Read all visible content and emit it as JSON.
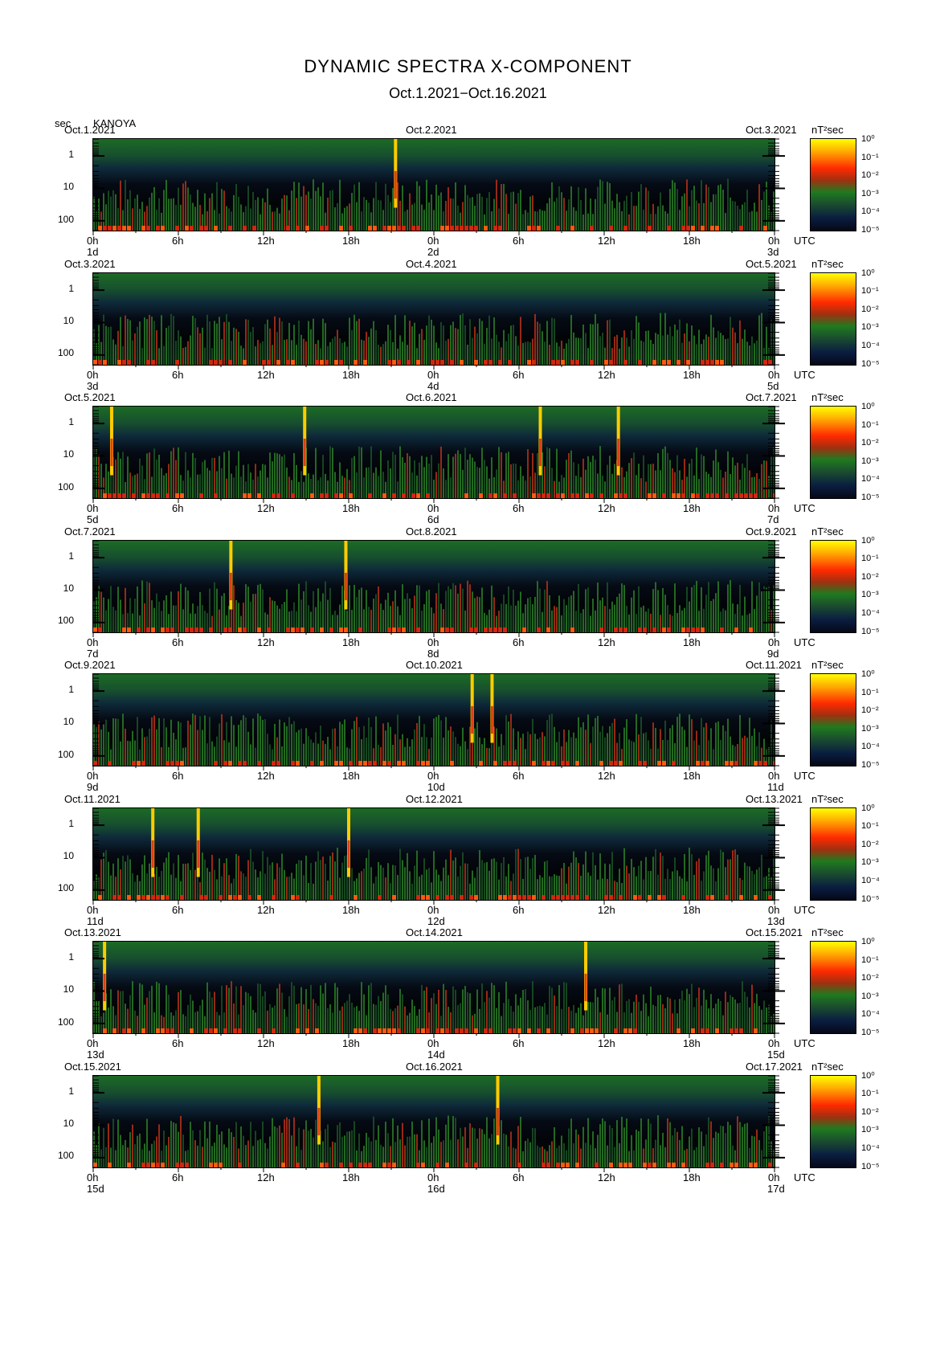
{
  "title": "DYNAMIC SPECTRA X-COMPONENT",
  "subtitle": "Oct.1.2021−Oct.16.2021",
  "y_unit": "sec",
  "station": "KANOYA",
  "colorbar_unit": "nT²sec",
  "colorbar_ticks": [
    "10⁰",
    "10⁻¹",
    "10⁻²",
    "10⁻³",
    "10⁻⁴",
    "10⁻⁵"
  ],
  "x_tick_labels": [
    "0h",
    "6h",
    "12h",
    "18h",
    "0h",
    "6h",
    "12h",
    "18h",
    "0h"
  ],
  "x_unit": "UTC",
  "y_tick_labels": [
    "1",
    "10",
    "100"
  ],
  "chart_data": {
    "type": "heatmap",
    "title": "DYNAMIC SPECTRA X-COMPONENT",
    "subtitle": "Oct.1.2021−Oct.16.2021",
    "ylabel": "sec",
    "xlabel": "UTC",
    "y_scale": "log",
    "ylim": [
      0.3,
      200
    ],
    "colorbar": {
      "unit": "nT²sec",
      "range": [
        "10^-5",
        "10^0"
      ],
      "scale": "log"
    },
    "panels": [
      {
        "start": "Oct.1.2021",
        "mid": "Oct.2.2021",
        "end": "Oct.3.2021",
        "day_start": "1d",
        "day_mid": "2d",
        "day_end": "3d",
        "spikes_hours": [
          21.3
        ]
      },
      {
        "start": "Oct.3.2021",
        "mid": "Oct.4.2021",
        "end": "Oct.5.2021",
        "day_start": "3d",
        "day_mid": "4d",
        "day_end": "5d",
        "spikes_hours": []
      },
      {
        "start": "Oct.5.2021",
        "mid": "Oct.6.2021",
        "end": "Oct.7.2021",
        "day_start": "5d",
        "day_mid": "6d",
        "day_end": "7d",
        "spikes_hours": [
          1.3,
          14.9,
          31.5,
          37.0
        ]
      },
      {
        "start": "Oct.7.2021",
        "mid": "Oct.8.2021",
        "end": "Oct.9.2021",
        "day_start": "7d",
        "day_mid": "8d",
        "day_end": "9d",
        "spikes_hours": [
          9.7,
          17.8
        ]
      },
      {
        "start": "Oct.9.2021",
        "mid": "Oct.10.2021",
        "end": "Oct.11.2021",
        "day_start": "9d",
        "day_mid": "10d",
        "day_end": "11d",
        "spikes_hours": [
          26.7,
          28.1
        ]
      },
      {
        "start": "Oct.11.2021",
        "mid": "Oct.12.2021",
        "end": "Oct.13.2021",
        "day_start": "11d",
        "day_mid": "12d",
        "day_end": "13d",
        "spikes_hours": [
          4.2,
          7.4,
          18.0
        ]
      },
      {
        "start": "Oct.13.2021",
        "mid": "Oct.14.2021",
        "end": "Oct.15.2021",
        "day_start": "13d",
        "day_mid": "14d",
        "day_end": "15d",
        "spikes_hours": [
          0.8,
          34.7
        ]
      },
      {
        "start": "Oct.15.2021",
        "mid": "Oct.16.2021",
        "end": "Oct.17.2021",
        "day_start": "15d",
        "day_mid": "16d",
        "day_end": "17d",
        "spikes_hours": [
          15.9,
          28.5
        ]
      }
    ]
  }
}
